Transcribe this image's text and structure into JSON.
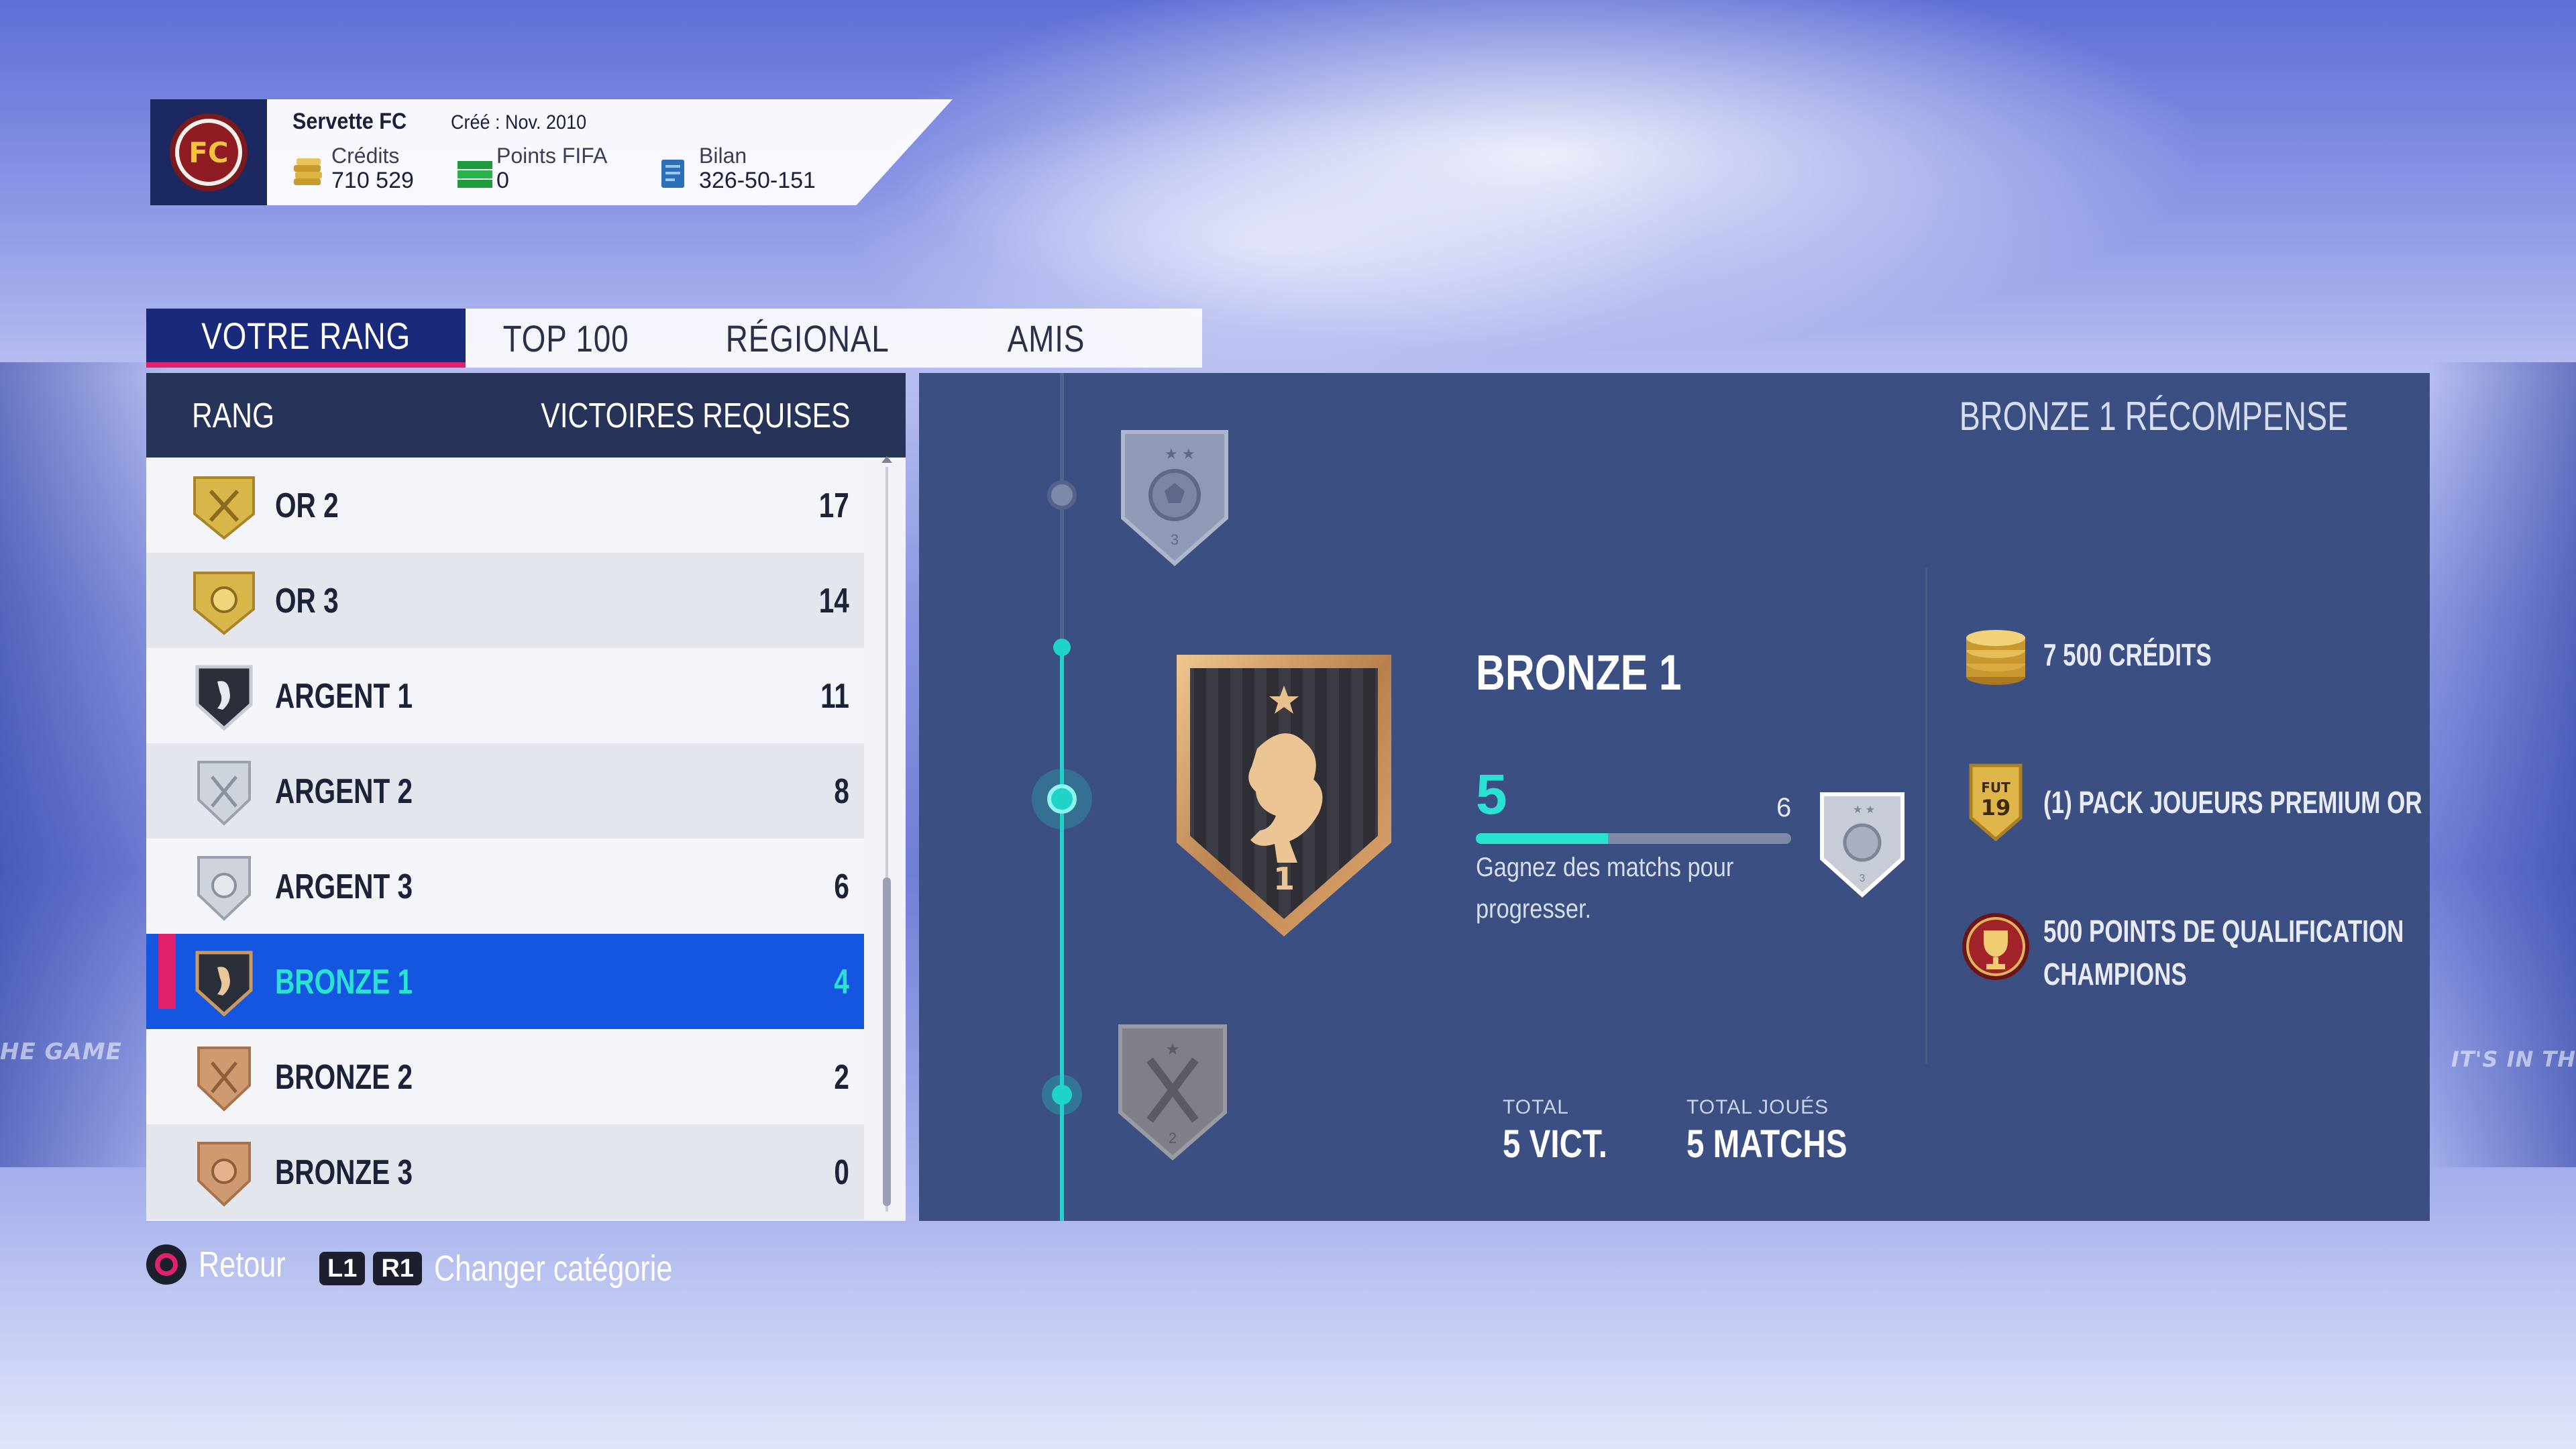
{
  "background": {
    "left_text": "HE GAME",
    "right_text": "IT'S IN TH"
  },
  "club": {
    "name": "Servette FC",
    "created": "Créé : Nov. 2010",
    "badge_letters": "FC",
    "stats": [
      {
        "label": "Crédits",
        "value": "710 529",
        "icon": "coins-icon"
      },
      {
        "label": "Points FIFA",
        "value": "0",
        "icon": "fifa-points-icon"
      },
      {
        "label": "Bilan",
        "value": "326-50-151",
        "icon": "record-icon"
      }
    ]
  },
  "tabs": [
    {
      "label": "VOTRE RANG",
      "active": true
    },
    {
      "label": "TOP 100",
      "active": false
    },
    {
      "label": "RÉGIONAL",
      "active": false
    },
    {
      "label": "AMIS",
      "active": false
    }
  ],
  "rank_list": {
    "header_rank": "RANG",
    "header_wins": "VICTOIRES REQUISES",
    "rows": [
      {
        "name": "OR 2",
        "wins": "17",
        "tier": "gold",
        "selected": false
      },
      {
        "name": "OR 3",
        "wins": "14",
        "tier": "gold",
        "selected": false
      },
      {
        "name": "ARGENT 1",
        "wins": "11",
        "tier": "silver-dark",
        "selected": false
      },
      {
        "name": "ARGENT 2",
        "wins": "8",
        "tier": "silver",
        "selected": false
      },
      {
        "name": "ARGENT 3",
        "wins": "6",
        "tier": "silver",
        "selected": false
      },
      {
        "name": "BRONZE 1",
        "wins": "4",
        "tier": "bronze-dark",
        "selected": true
      },
      {
        "name": "BRONZE 2",
        "wins": "2",
        "tier": "bronze",
        "selected": false
      },
      {
        "name": "BRONZE 3",
        "wins": "0",
        "tier": "bronze",
        "selected": false
      }
    ]
  },
  "detail": {
    "reward_title": "BRONZE 1 RÉCOMPENSE",
    "rank_name": "BRONZE 1",
    "badge_number": "1",
    "next_badge_number": "3",
    "prev_badge_number": "2",
    "progress_current": "5",
    "progress_target": "6",
    "progress_fraction": 0.42,
    "progress_hint": "Gagnez des matchs pour progresser.",
    "totals": [
      {
        "label": "TOTAL",
        "value": "5 VICT."
      },
      {
        "label": "TOTAL JOUÉS",
        "value": "5 MATCHS"
      }
    ],
    "rewards": [
      {
        "text": "7 500 CRÉDITS",
        "icon": "coins-stack-icon"
      },
      {
        "text": "(1) PACK JOUEURS PREMIUM OR",
        "icon": "fut-pack-icon",
        "pack_label_top": "FUT",
        "pack_label_bottom": "19"
      },
      {
        "text_line1": "500 POINTS DE QUALIFICATION",
        "text_line2": "CHAMPIONS",
        "icon": "trophy-icon"
      }
    ]
  },
  "footer": {
    "back_label": "Retour",
    "l1": "L1",
    "r1": "R1",
    "change_label": "Changer catégorie"
  },
  "colors": {
    "accent_pink": "#e3206b",
    "accent_cyan": "#29e3d2",
    "selected_row": "#1556e0",
    "panel": "#3c4f82"
  }
}
